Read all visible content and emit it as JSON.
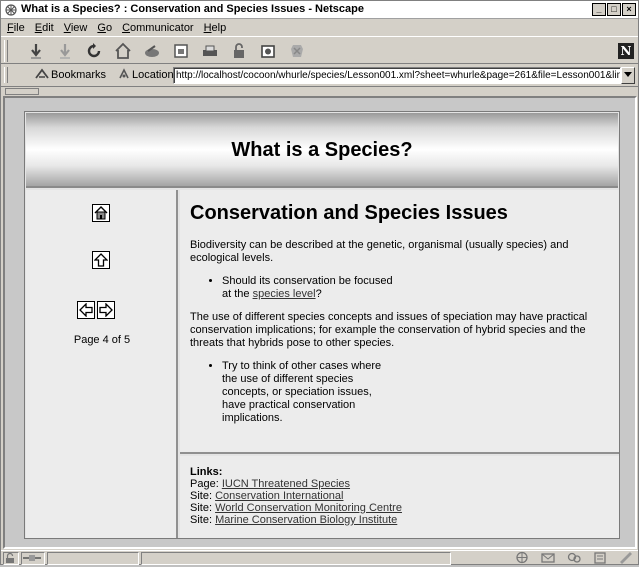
{
  "window": {
    "title": "What is a Species? : Conservation and Species Issues - Netscape",
    "buttons": [
      "_",
      "□",
      "×"
    ]
  },
  "menu": [
    {
      "label": "File",
      "key": "F"
    },
    {
      "label": "Edit",
      "key": "E"
    },
    {
      "label": "View",
      "key": "V"
    },
    {
      "label": "Go",
      "key": "G"
    },
    {
      "label": "Communicator",
      "key": "C"
    },
    {
      "label": "Help",
      "key": "H"
    }
  ],
  "toolbar": {
    "icons": [
      "back-icon",
      "forward-icon",
      "reload-icon",
      "home-icon",
      "search-icon",
      "my-netscape-icon",
      "print-icon",
      "security-icon",
      "shop-icon",
      "stop-icon"
    ],
    "logo": "N"
  },
  "location": {
    "bookmarks_label": "Bookmarks",
    "location_label": "Location:",
    "url": "http://localhost/cocoon/whurle/species/Lesson001.xml?sheet=whurle&page=261&file=Lesson001&links=lin"
  },
  "page": {
    "header": "What is a Species?",
    "counter": "Page 4 of 5",
    "nav": {
      "home": "home",
      "up": "up",
      "prev": "previous",
      "next": "next"
    },
    "heading": "Conservation and Species Issues",
    "para1": "Biodiversity can be described at the genetic, organismal (usually species) and ecological levels.",
    "bullet1_pre": "Should its conservation be focused at the ",
    "bullet1_link": "species level",
    "bullet1_post": "?",
    "para2": "The use of different species concepts and issues of speciation may have practical conservation implications; for example the conservation of hybrid species and the threats that hybrids pose to other species.",
    "bullet2": "Try to think of other cases where the use of different species concepts, or speciation issues, have practical conservation implications."
  },
  "links": {
    "title": "Links:",
    "items": [
      {
        "prefix": "Page:",
        "text": "IUCN Threatened Species"
      },
      {
        "prefix": "Site:",
        "text": "Conservation International"
      },
      {
        "prefix": "Site:",
        "text": "World Conservation Monitoring Centre"
      },
      {
        "prefix": "Site:",
        "text": "Marine Conservation Biology Institute"
      }
    ]
  }
}
